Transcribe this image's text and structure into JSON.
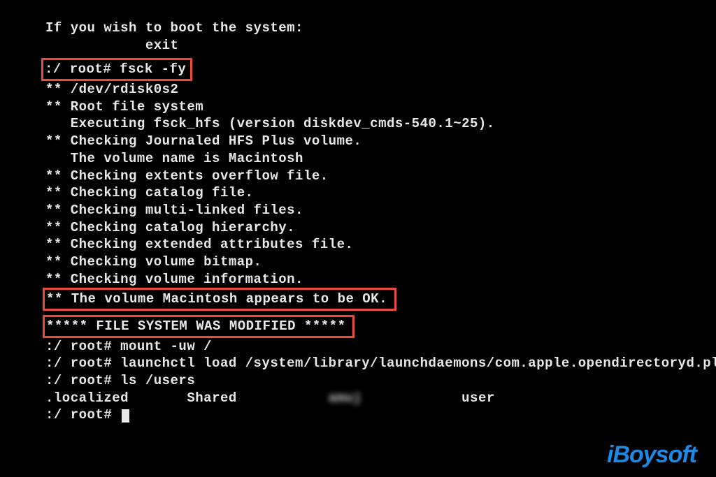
{
  "lines": {
    "boot_msg": "If you wish to boot the system:",
    "exit": "            exit",
    "prompt_fsck": ":/ root# fsck -fy",
    "dev": "** /dev/rdisk0s2",
    "rootfs": "** Root file system",
    "exec": "   Executing fsck_hfs (version diskdev_cmds-540.1~25).",
    "check_jour": "** Checking Journaled HFS Plus volume.",
    "volname": "   The volume name is Macintosh",
    "check_ext": "** Checking extents overflow file.",
    "check_cat": "** Checking catalog file.",
    "check_multi": "** Checking multi-linked files.",
    "check_hier": "** Checking catalog hierarchy.",
    "check_attr": "** Checking extended attributes file.",
    "check_bitmap": "** Checking volume bitmap.",
    "check_info": "** Checking volume information.",
    "vol_ok": "** The volume Macintosh appears to be OK.",
    "fs_mod": "***** FILE SYSTEM WAS MODIFIED *****",
    "prompt_mount": ":/ root# mount -uw /",
    "prompt_launch": ":/ root# launchctl load /system/library/launchdaemons/com.apple.opendirectoryd.plist",
    "prompt_ls": ":/ root# ls /users",
    "ls_localized": ".localized",
    "ls_shared": "Shared",
    "ls_blurred": "amuj",
    "ls_user": "user",
    "prompt_final": ":/ root# "
  },
  "watermark": "iBoysoft"
}
